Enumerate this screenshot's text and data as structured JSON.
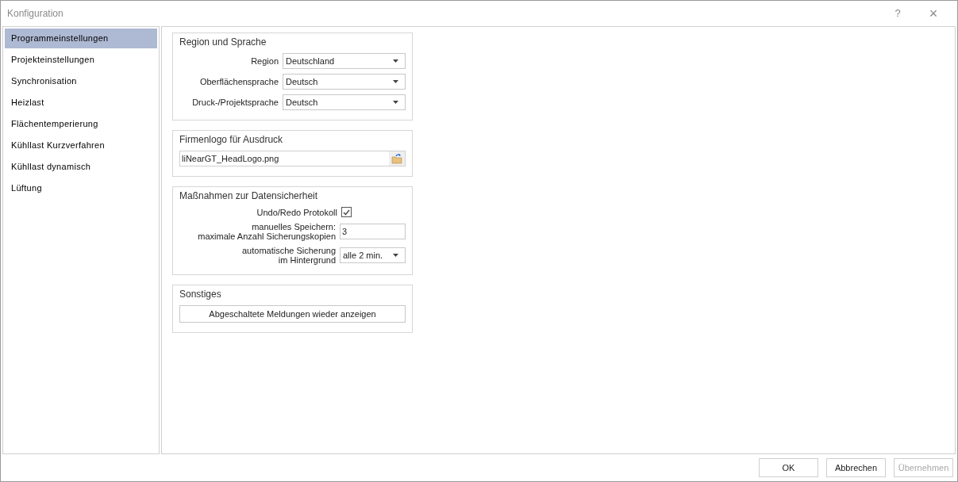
{
  "window": {
    "title": "Konfiguration",
    "help": "?",
    "close": "×"
  },
  "sidebar": {
    "items": [
      {
        "label": "Programmeinstellungen",
        "selected": true
      },
      {
        "label": "Projekteinstellungen",
        "selected": false
      },
      {
        "label": "Synchronisation",
        "selected": false
      },
      {
        "label": "Heizlast",
        "selected": false
      },
      {
        "label": "Flächentemperierung",
        "selected": false
      },
      {
        "label": "Kühllast Kurzverfahren",
        "selected": false
      },
      {
        "label": "Kühllast dynamisch",
        "selected": false
      },
      {
        "label": "Lüftung",
        "selected": false
      }
    ]
  },
  "groups": [
    {
      "title": "Region und Sprache",
      "rows": [
        {
          "kind": "dropdown",
          "label": "Region",
          "value": "Deutschland"
        },
        {
          "kind": "dropdown",
          "label": "Oberflächensprache",
          "value": "Deutsch"
        },
        {
          "kind": "dropdown",
          "label": "Druck-/Projektsprache",
          "value": "Deutsch"
        }
      ]
    },
    {
      "title": "Firmenlogo für Ausdruck",
      "rows": [
        {
          "kind": "file",
          "value": "liNearGT_HeadLogo.png"
        }
      ]
    },
    {
      "title": "Maßnahmen zur Datensicherheit",
      "rows": [
        {
          "kind": "checkbox",
          "label": "Undo/Redo Protokoll",
          "checked": true
        },
        {
          "kind": "text",
          "label": "manuelles Speichern:\nmaximale Anzahl Sicherungskopien",
          "value": "3"
        },
        {
          "kind": "dropdown",
          "label": "automatische Sicherung\nim Hintergrund",
          "value": "alle 2 min."
        }
      ]
    },
    {
      "title": "Sonstiges",
      "rows": [
        {
          "kind": "button",
          "label": "Abgeschaltete Meldungen wieder anzeigen"
        }
      ]
    }
  ],
  "buttons": [
    {
      "label": "OK",
      "disabled": false
    },
    {
      "label": "Abbrechen",
      "disabled": false
    },
    {
      "label": "Übernehmen",
      "disabled": true
    }
  ]
}
